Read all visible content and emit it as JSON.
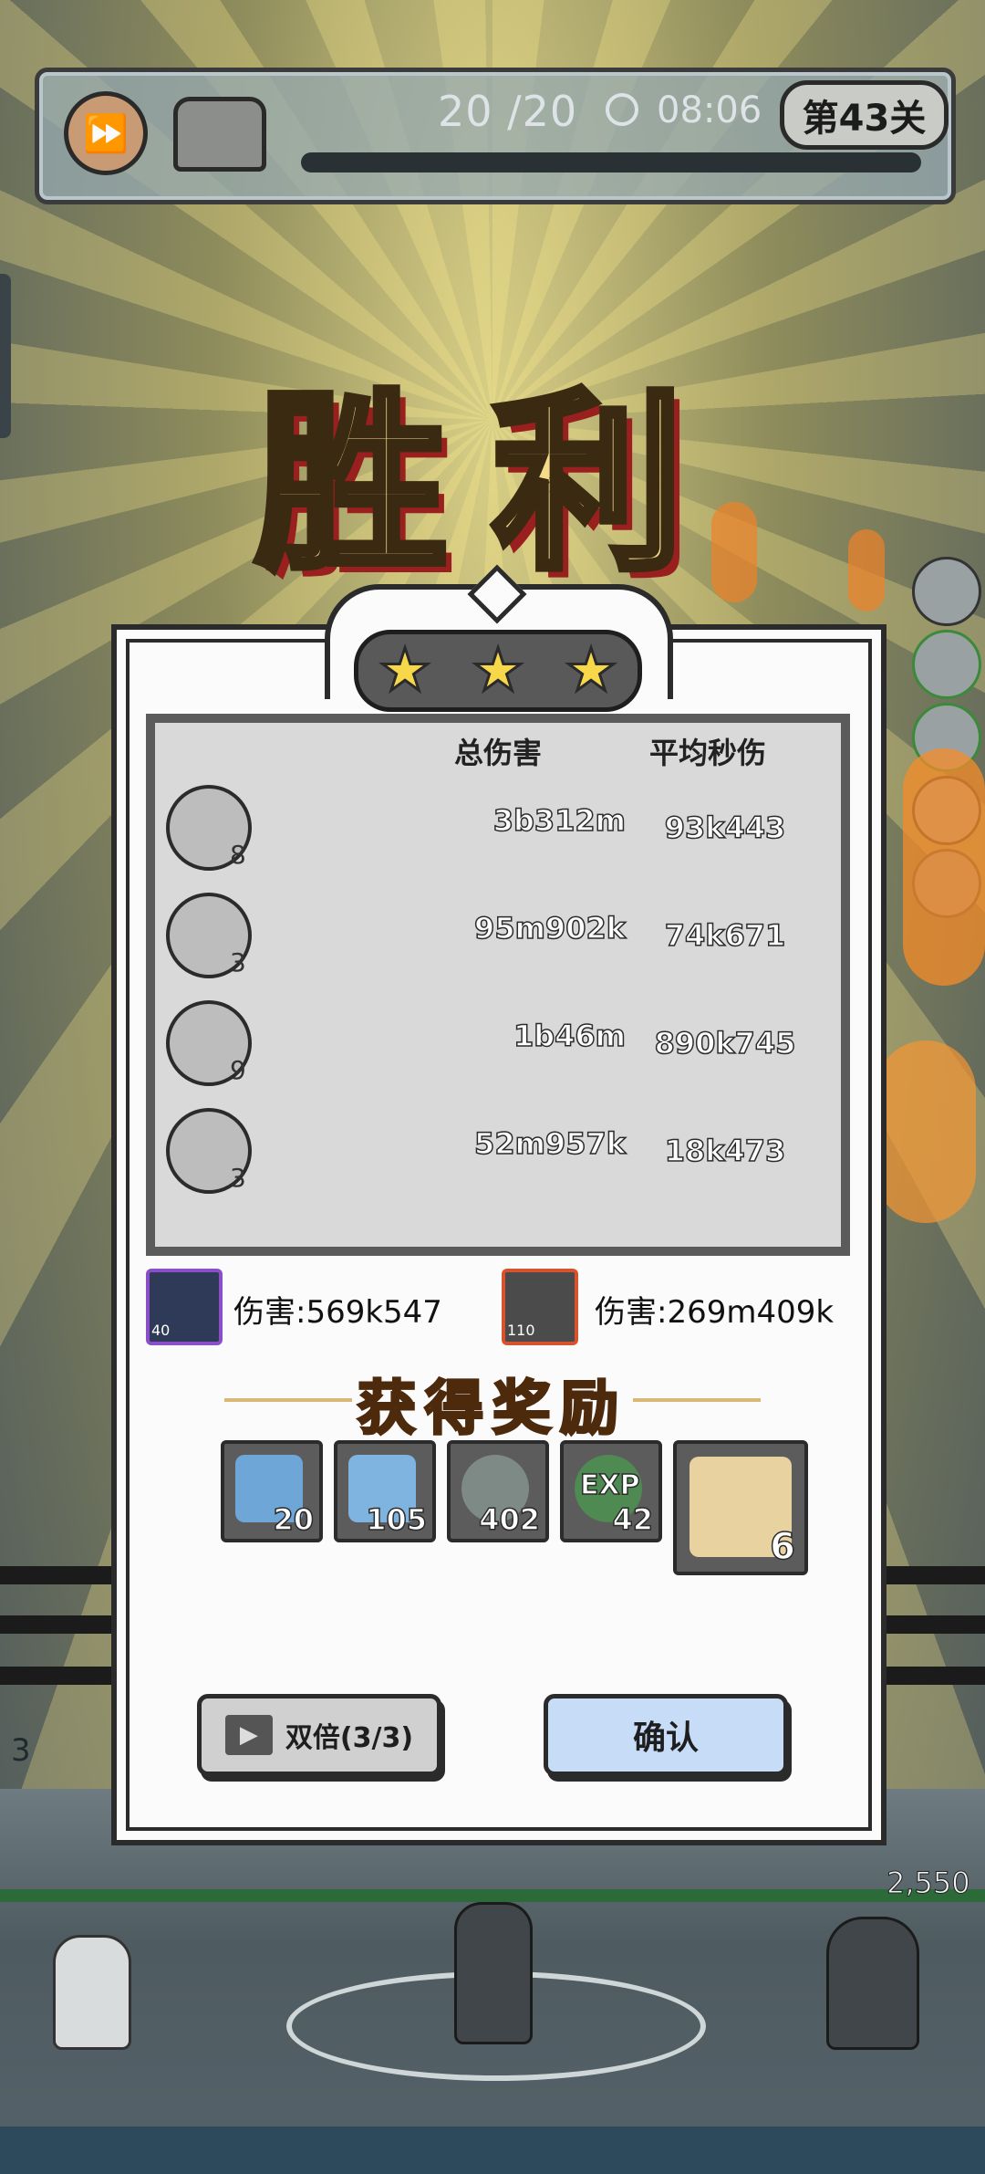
{
  "hud": {
    "wave": "20 /20",
    "timer": "08:06",
    "level": "第43关"
  },
  "title": "胜利",
  "stars": 3,
  "stats": {
    "header_total": "总伤害",
    "header_dps": "平均秒伤",
    "rows": [
      {
        "icon": "splash-skill-icon",
        "level": "8",
        "total": "3b312m",
        "dps": "93k443"
      },
      {
        "icon": "slash-skill-icon",
        "level": "3",
        "total": "95m902k",
        "dps": "74k671"
      },
      {
        "icon": "wind-skill-icon",
        "level": "9",
        "total": "1b46m",
        "dps": "890k745"
      },
      {
        "icon": "lightning-skill-icon",
        "level": "3",
        "total": "52m957k",
        "dps": "18k473"
      }
    ]
  },
  "heroes": [
    {
      "level": "40",
      "damage": "伤害:569k547",
      "frame_color": "#8a4fc8"
    },
    {
      "level": "110",
      "damage": "伤害:269m409k",
      "frame_color": "#d8522e"
    }
  ],
  "rewards": {
    "title": "获得奖励",
    "items": [
      {
        "icon": "blue-bomb-gem-icon",
        "count": "20"
      },
      {
        "icon": "blue-scroll-gem-icon",
        "count": "105"
      },
      {
        "icon": "green-leaf-rune-icon",
        "count": "402"
      },
      {
        "icon": "exp-orb-icon",
        "label": "EXP",
        "count": "42"
      },
      {
        "icon": "treasure-map-icon",
        "count": "6"
      }
    ]
  },
  "buttons": {
    "double": "双倍(3/3)",
    "confirm": "确认"
  },
  "side": {
    "left_counter": "3",
    "enemy_hp": "2,550"
  },
  "colors": {
    "confirm_bg": "#c7dcf7",
    "double_bg": "#d0d0d0",
    "reward_gold": "#f0b55e"
  }
}
